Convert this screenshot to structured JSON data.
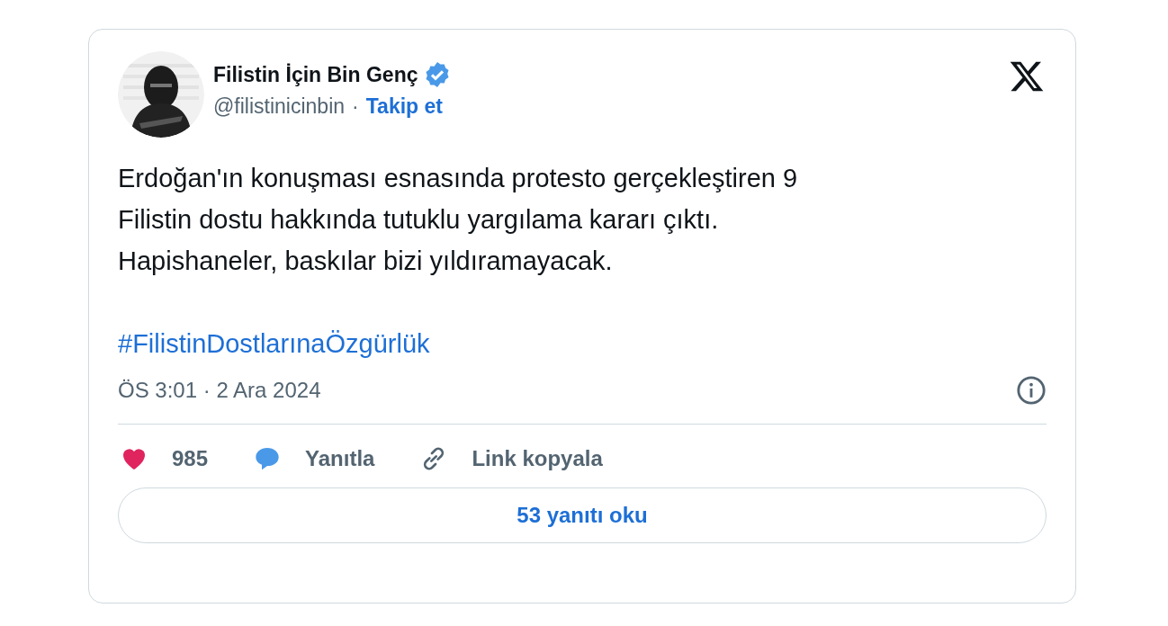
{
  "author": {
    "name": "Filistin İçin Bin Genç",
    "verified": true,
    "handle": "@filistinicinbin",
    "separator": "·",
    "follow": "Takip et"
  },
  "post": {
    "text": "Erdoğan'ın konuşması esnasında protesto gerçekleştiren 9\nFilistin dostu hakkında tutuklu yargılama kararı çıktı.\nHapishaneler, baskılar bizi yıldıramayacak.",
    "hashtag": "#FilistinDostlarınaÖzgürlük",
    "timestamp": "ÖS 3:01 · 2 Ara 2024"
  },
  "actions": [
    {
      "kind": "like",
      "label": "985"
    },
    {
      "kind": "reply",
      "label": "Yanıtla"
    },
    {
      "kind": "link",
      "label": "Link kopyala"
    }
  ],
  "read_replies": "53 yanıtı oku"
}
